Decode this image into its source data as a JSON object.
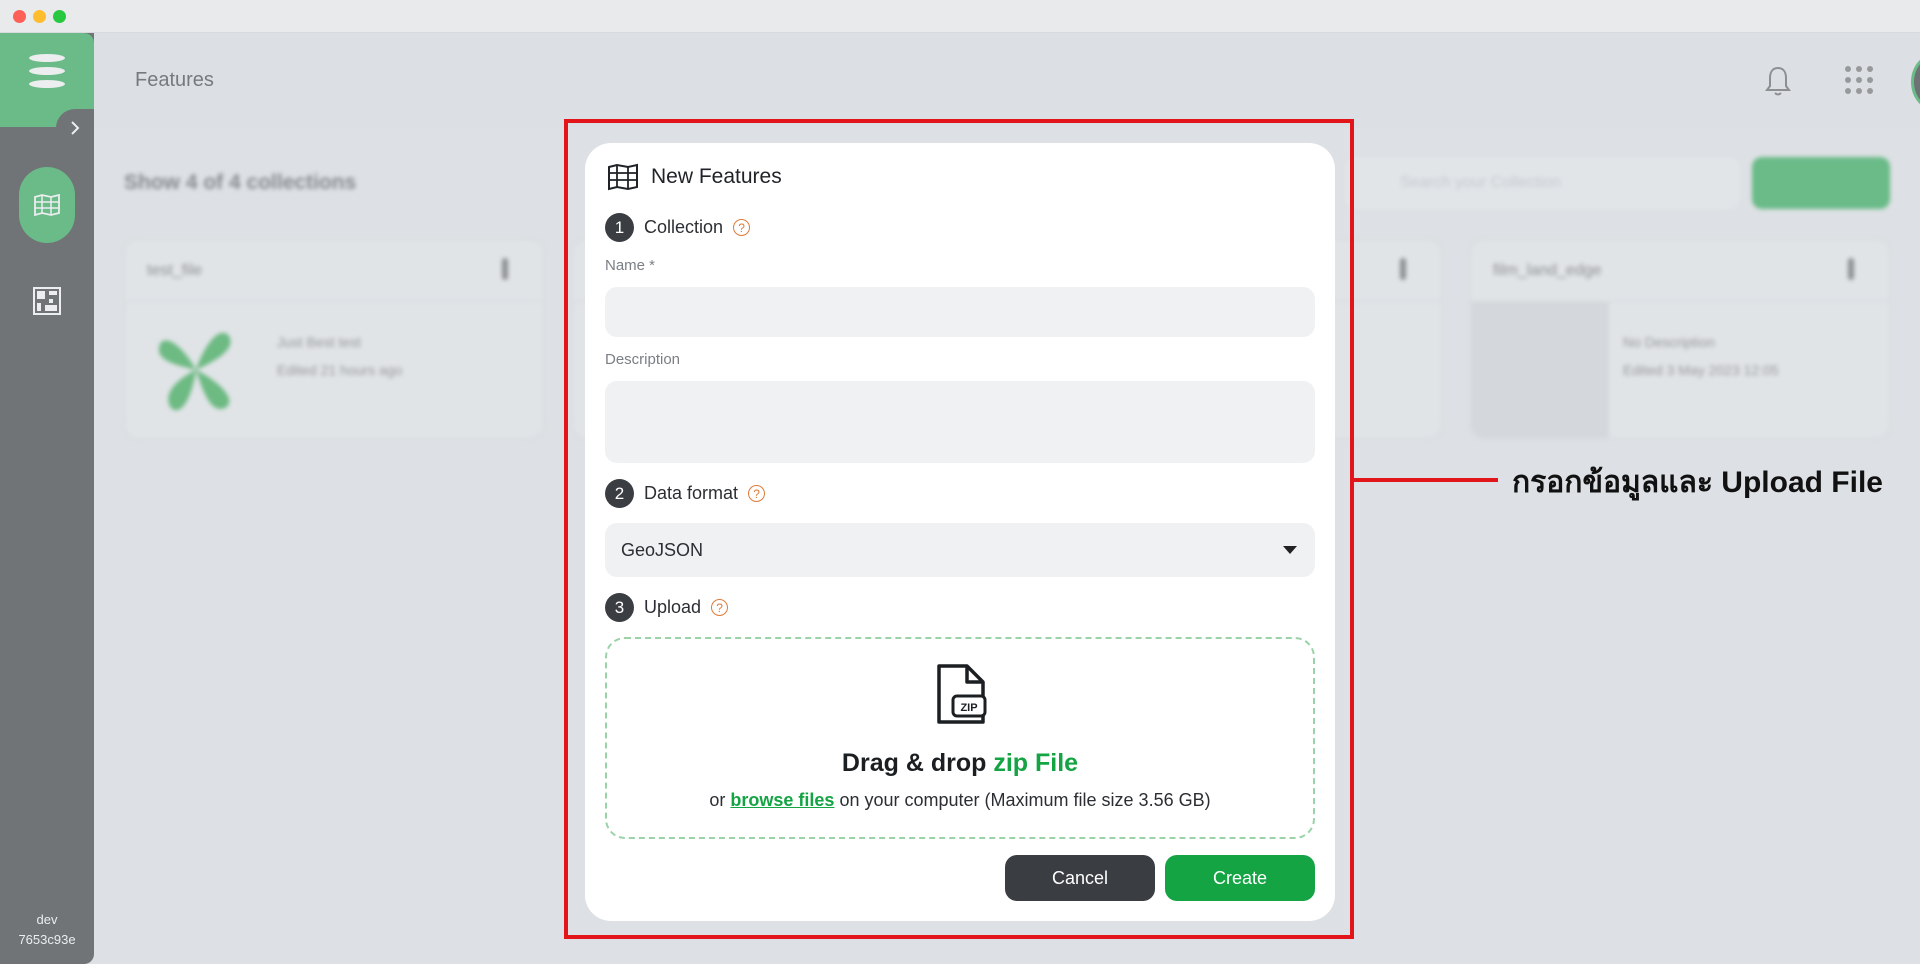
{
  "app": {
    "page_title": "Features",
    "env": {
      "name": "dev",
      "build": "7653c93e"
    }
  },
  "collections": {
    "count_text": "Show 4 of 4 collections",
    "search_placeholder": "Search your Collection",
    "cards": [
      {
        "name": "test_file",
        "meta1": "Just Best test",
        "meta2": "Edited 21 hours ago"
      },
      {
        "name": "film_land_edge",
        "meta1": "No Description",
        "meta2": "Edited 3 May 2023 12:05"
      }
    ]
  },
  "modal": {
    "title": "New Features",
    "steps": [
      {
        "num": "1",
        "label": "Collection"
      },
      {
        "num": "2",
        "label": "Data format"
      },
      {
        "num": "3",
        "label": "Upload"
      }
    ],
    "help_glyph": "?",
    "name_label": "Name *",
    "name_value": "",
    "description_label": "Description",
    "description_value": "",
    "data_format_value": "GeoJSON",
    "upload": {
      "title_prefix": "Drag & drop",
      "title_accent": "zip File",
      "sub_prefix": "or",
      "sub_link": "browse files",
      "sub_suffix": "on your computer (Maximum file size 3.56 GB)",
      "file_badge": "ZIP"
    },
    "cancel_label": "Cancel",
    "create_label": "Create"
  },
  "annotation": {
    "callout_text": "กรอกข้อมูลและ Upload File",
    "color": "#e2151b"
  },
  "colors": {
    "brand_green": "#14a444",
    "sidebar_bg": "#202326",
    "dark_button": "#3a3d42",
    "help_orange": "#e07b39"
  }
}
